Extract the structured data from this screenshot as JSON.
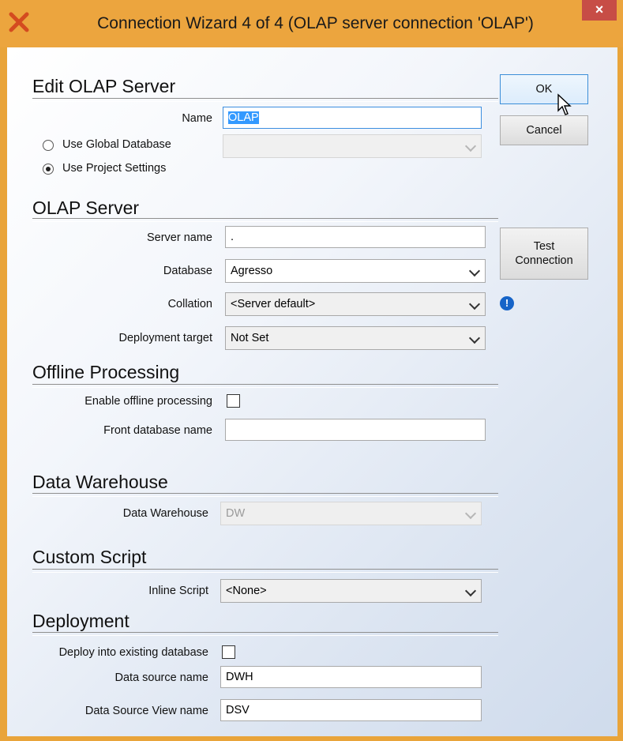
{
  "window": {
    "title": "Connection Wizard 4 of 4 (OLAP server connection  'OLAP')",
    "close_glyph": "×"
  },
  "buttons": {
    "ok": "OK",
    "cancel": "Cancel",
    "test_line1": "Test",
    "test_line2": "Connection"
  },
  "edit_olap": {
    "heading": "Edit OLAP Server",
    "name_label": "Name",
    "name_value": "OLAP",
    "radio_global": "Use Global Database",
    "radio_project": "Use Project Settings",
    "global_db_value": ""
  },
  "olap_server": {
    "heading": "OLAP Server",
    "server_label": "Server name",
    "server_value": ".",
    "database_label": "Database",
    "database_value": "Agresso",
    "collation_label": "Collation",
    "collation_value": "<Server default>",
    "target_label": "Deployment target",
    "target_value": "Not Set"
  },
  "offline": {
    "heading": "Offline Processing",
    "enable_label": "Enable offline processing",
    "front_label": "Front database name",
    "front_value": ""
  },
  "dw": {
    "heading": "Data Warehouse",
    "label": "Data Warehouse",
    "value": "DW"
  },
  "script": {
    "heading": "Custom Script",
    "label": "Inline Script",
    "value": "<None>"
  },
  "deployment": {
    "heading": "Deployment",
    "existing_label": "Deploy into existing database",
    "ds_label": "Data source name",
    "ds_value": "DWH",
    "dsv_label": "Data Source View name",
    "dsv_value": "DSV"
  },
  "icons": {
    "app": "wizard-logo-icon",
    "info": "info-icon",
    "close": "close-icon"
  },
  "colors": {
    "title_bar": "#eca53e",
    "close": "#c74d46",
    "accent": "#3c8ee0",
    "info": "#1664c8"
  }
}
